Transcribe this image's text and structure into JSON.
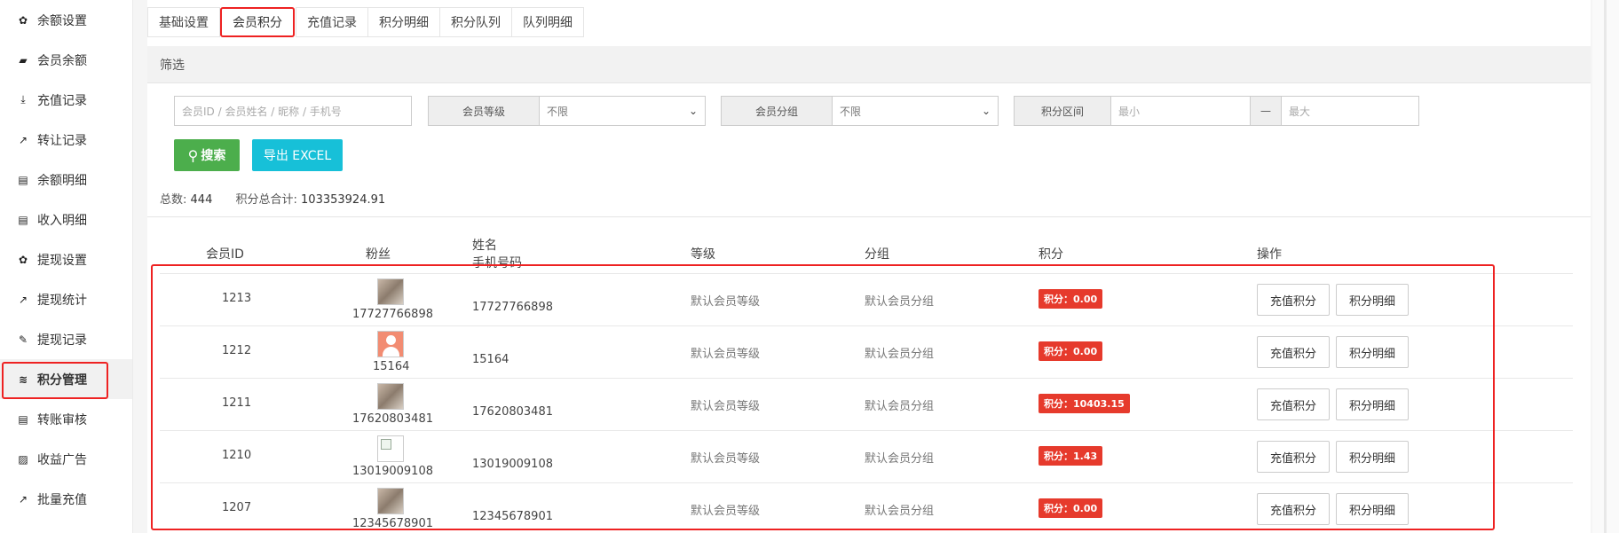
{
  "sidebar": {
    "items": [
      {
        "label": "余额设置",
        "icon": "gear-icon",
        "glyph": "✿"
      },
      {
        "label": "会员余额",
        "icon": "book-icon",
        "glyph": "▰"
      },
      {
        "label": "充值记录",
        "icon": "download-icon",
        "glyph": "⤓"
      },
      {
        "label": "转让记录",
        "icon": "external-link-icon",
        "glyph": "↗"
      },
      {
        "label": "余额明细",
        "icon": "file-icon",
        "glyph": "▤"
      },
      {
        "label": "收入明细",
        "icon": "file-icon",
        "glyph": "▤"
      },
      {
        "label": "提现设置",
        "icon": "gear-icon",
        "glyph": "✿"
      },
      {
        "label": "提现统计",
        "icon": "line-chart-icon",
        "glyph": "↗"
      },
      {
        "label": "提现记录",
        "icon": "pencil-icon",
        "glyph": "✎"
      },
      {
        "label": "积分管理",
        "icon": "database-icon",
        "glyph": "≋"
      },
      {
        "label": "转账审核",
        "icon": "file-icon",
        "glyph": "▤"
      },
      {
        "label": "收益广告",
        "icon": "image-icon",
        "glyph": "▨"
      },
      {
        "label": "批量充值",
        "icon": "line-chart-icon",
        "glyph": "↗"
      }
    ]
  },
  "tabs": [
    "基础设置",
    "会员积分",
    "充值记录",
    "积分明细",
    "积分队列",
    "队列明细"
  ],
  "filter": {
    "title": "筛选",
    "keyword_placeholder": "会员ID / 会员姓名 / 昵称 / 手机号",
    "level_label": "会员等级",
    "level_value": "不限",
    "group_label": "会员分组",
    "group_value": "不限",
    "points_label": "积分区间",
    "min_placeholder": "最小",
    "range_sep": "—",
    "max_placeholder": "最大",
    "search_label": "搜索",
    "export_label": "导出 EXCEL"
  },
  "summary": {
    "total_label": "总数:",
    "total_value": "444",
    "points_label": "积分总合计:",
    "points_value": "103353924.91"
  },
  "table": {
    "headers": {
      "id": "会员ID",
      "fans": "粉丝",
      "name": "姓名",
      "phone": "手机号码",
      "level": "等级",
      "group": "分组",
      "points": "积分",
      "ops": "操作"
    },
    "rows": [
      {
        "id": "1213",
        "avatar": "photo",
        "fan": "17727766898",
        "name": "17727766898",
        "level": "默认会员等级",
        "group": "默认会员分组",
        "points": "积分：0.00",
        "op1": "充值积分",
        "op2": "积分明细"
      },
      {
        "id": "1212",
        "avatar": "person",
        "fan": "15164",
        "name": "15164",
        "level": "默认会员等级",
        "group": "默认会员分组",
        "points": "积分：0.00",
        "op1": "充值积分",
        "op2": "积分明细"
      },
      {
        "id": "1211",
        "avatar": "photo",
        "fan": "17620803481",
        "name": "17620803481",
        "level": "默认会员等级",
        "group": "默认会员分组",
        "points": "积分：10403.15",
        "op1": "充值积分",
        "op2": "积分明细"
      },
      {
        "id": "1210",
        "avatar": "broken",
        "fan": "13019009108",
        "name": "13019009108",
        "level": "默认会员等级",
        "group": "默认会员分组",
        "points": "积分：1.43",
        "op1": "充值积分",
        "op2": "积分明细"
      },
      {
        "id": "1207",
        "avatar": "photo",
        "fan": "12345678901",
        "name": "12345678901",
        "level": "默认会员等级",
        "group": "默认会员分组",
        "points": "积分：0.00",
        "op1": "充值积分",
        "op2": "积分明细"
      }
    ]
  },
  "colors": {
    "accent_red": "#e22222",
    "search_green": "#4cae4c",
    "export_cyan": "#17c0d8",
    "badge_red": "#e63a2c"
  }
}
